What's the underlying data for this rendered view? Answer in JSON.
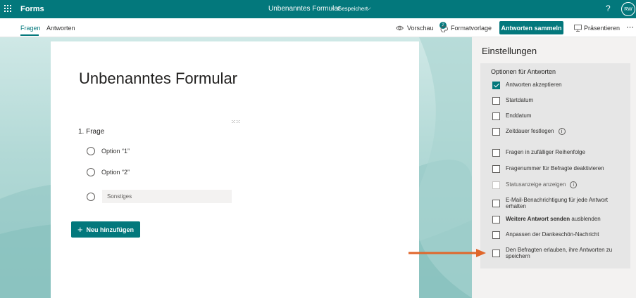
{
  "topbar": {
    "app_name": "Forms",
    "doc_title": "Unbenanntes Formular",
    "separator": "-",
    "doc_status": "Gespeichert",
    "avatar_initials": "RW",
    "help_icon": "question-mark-icon",
    "waffle_icon": "app-launcher-icon"
  },
  "cmdbar": {
    "tabs": [
      {
        "label": "Fragen",
        "active": true
      },
      {
        "label": "Antworten",
        "active": false
      }
    ],
    "preview_label": "Vorschau",
    "theme_label": "Formatvorlage",
    "theme_badge": "2",
    "collect_label": "Antworten sammeln",
    "present_label": "Präsentieren"
  },
  "form": {
    "title": "Unbenanntes Formular",
    "question": "1. Frage",
    "options": [
      "Option “1”",
      "Option “2”"
    ],
    "other_placeholder": "Sonstiges",
    "add_label": "Neu hinzufügen"
  },
  "settings": {
    "title": "Einstellungen",
    "section_title": "Optionen für Antworten",
    "items": [
      {
        "label": "Antworten akzeptieren",
        "checked": true
      },
      {
        "label": "Startdatum",
        "checked": false
      },
      {
        "label": "Enddatum",
        "checked": false
      },
      {
        "label": "Zeitdauer festlegen",
        "checked": false,
        "info": true
      },
      {
        "label": "Fragen in zufälliger Reihenfolge",
        "checked": false
      },
      {
        "label": "Fragenummer für Befragte deaktivieren",
        "checked": false
      },
      {
        "label": "Statusanzeige anzeigen",
        "checked": false,
        "disabled": true,
        "info": true
      },
      {
        "label": "E-Mail-Benachrichtigung für jede Antwort erhalten",
        "checked": false
      },
      {
        "label_bold": "Weitere Antwort senden",
        "label_rest": " ausblenden",
        "checked": false
      },
      {
        "label": "Anpassen der Dankeschön-Nachricht",
        "checked": false
      },
      {
        "label": "Den Befragten erlauben, ihre Antworten zu speichern",
        "checked": false
      }
    ]
  },
  "colors": {
    "brand": "#03787c",
    "arrow": "#e0662a"
  }
}
